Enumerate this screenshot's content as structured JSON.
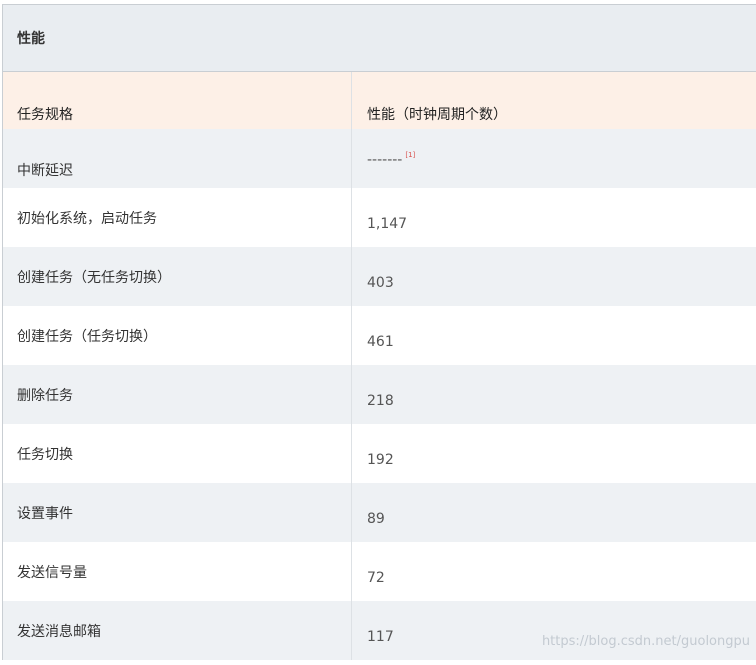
{
  "caption": "性能",
  "header": {
    "col1": "任务规格",
    "col2": "性能（时钟周期个数）"
  },
  "rows": [
    {
      "spec": "中断延迟",
      "value": "-------",
      "note": "[1]"
    },
    {
      "spec": "初始化系统，启动任务",
      "value": "1,147"
    },
    {
      "spec": "创建任务（无任务切换）",
      "value": "403"
    },
    {
      "spec": "创建任务（任务切换）",
      "value": "461"
    },
    {
      "spec": "删除任务",
      "value": "218"
    },
    {
      "spec": "任务切换",
      "value": "192"
    },
    {
      "spec": "设置事件",
      "value": "89"
    },
    {
      "spec": "发送信号量",
      "value": "72"
    },
    {
      "spec": "发送消息邮箱",
      "value": "117"
    }
  ],
  "watermark": "https://blog.csdn.net/guolongpu"
}
